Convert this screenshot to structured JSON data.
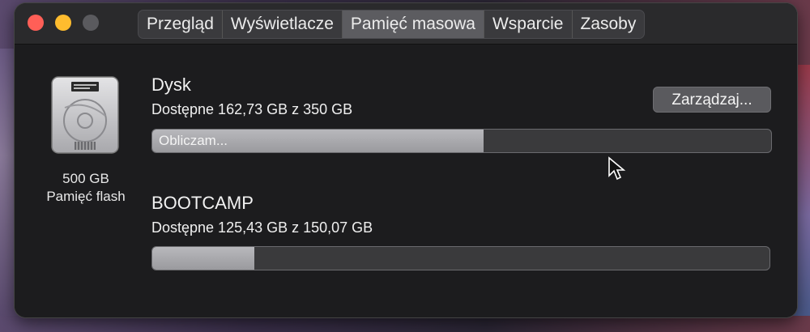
{
  "window": {
    "tabs": [
      {
        "label": "Przegląd",
        "active": false
      },
      {
        "label": "Wyświetlacze",
        "active": false
      },
      {
        "label": "Pamięć masowa",
        "active": true
      },
      {
        "label": "Wsparcie",
        "active": false
      },
      {
        "label": "Zasoby",
        "active": false
      }
    ]
  },
  "disk": {
    "size": "500 GB",
    "type": "Pamięć flash",
    "icon": "hard-drive-icon"
  },
  "volumes": [
    {
      "name": "Dysk",
      "available": "Dostępne 162,73 GB z 350 GB",
      "bar_label": "Obliczam...",
      "fill_fraction": 0.535
    },
    {
      "name": "BOOTCAMP",
      "available": "Dostępne 125,43 GB z 150,07 GB",
      "bar_label": "",
      "fill_fraction": 0.165
    }
  ],
  "manage_button": "Zarządzaj...",
  "colors": {
    "close": "#ff5f57",
    "minimize": "#febc2e",
    "zoom_inactive": "#5a5a5e"
  }
}
